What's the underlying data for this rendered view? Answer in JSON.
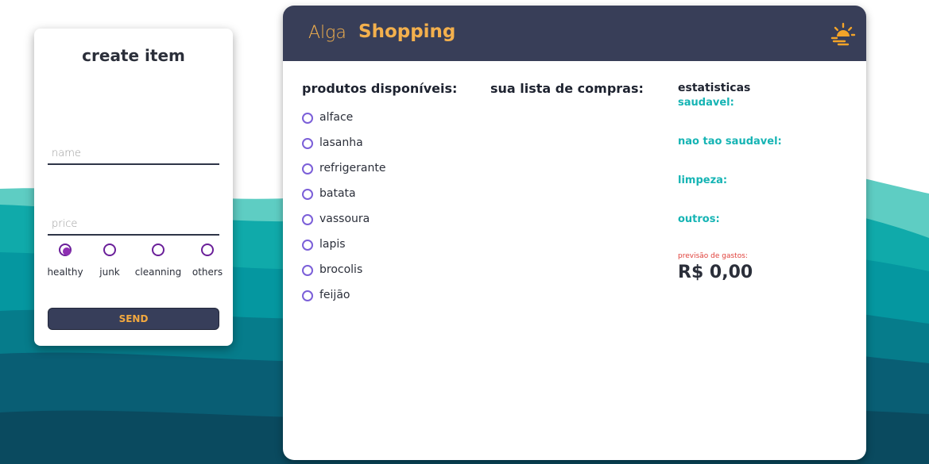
{
  "create_item": {
    "title": "create item",
    "name_placeholder": "name",
    "price_placeholder": "price",
    "categories": [
      {
        "label": "healthy",
        "checked": true
      },
      {
        "label": "junk",
        "checked": false
      },
      {
        "label": "cleanning",
        "checked": false
      },
      {
        "label": "others",
        "checked": false
      }
    ],
    "send_label": "SEND"
  },
  "header": {
    "brand_light": "Alga",
    "brand_bold": "Shopping",
    "theme_icon": "sun-sunset-icon"
  },
  "products": {
    "title": "produtos disponíveis:",
    "items": [
      "alface",
      "lasanha",
      "refrigerante",
      "batata",
      "vassoura",
      "lapis",
      "brocolis",
      "feijão"
    ]
  },
  "shopping_list": {
    "title": "sua lista de compras:"
  },
  "stats": {
    "title": "estatisticas",
    "healthy": "saudavel:",
    "not_healthy": "nao tao saudavel:",
    "cleaning": "limpeza:",
    "others": "outros:",
    "forecast_label": "previsão de gastos:",
    "forecast_value": "R$ 0,00"
  },
  "colors": {
    "header_bg": "#383e58",
    "accent_orange": "#f3b04d",
    "teal": "#16b4b4",
    "radio_purple": "#6a1f99",
    "product_radio": "#7b5fd8"
  }
}
